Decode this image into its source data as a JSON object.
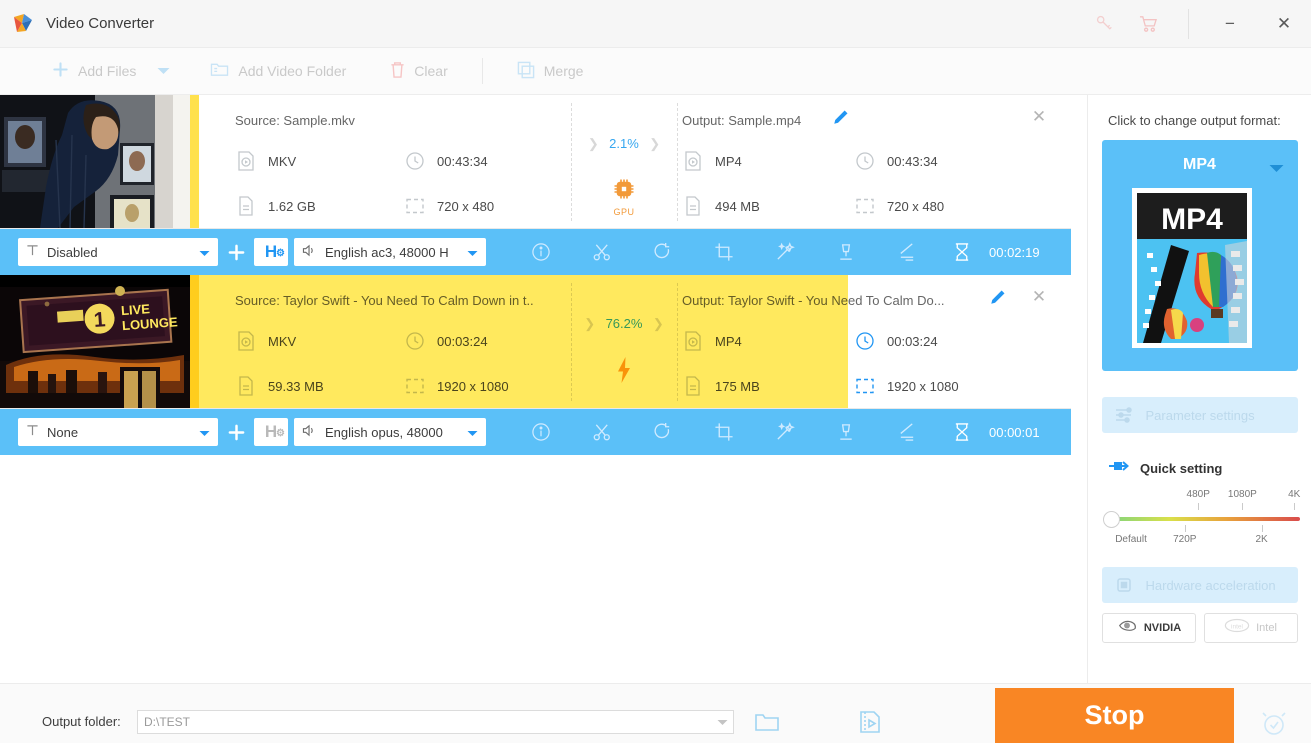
{
  "window": {
    "title": "Video Converter",
    "icons": {
      "key": "key-icon",
      "cart": "cart-icon",
      "minimize": "−",
      "close": "✕"
    }
  },
  "toolbar": {
    "add_files": "Add Files",
    "add_video_folder": "Add Video Folder",
    "clear": "Clear",
    "merge": "Merge"
  },
  "files": [
    {
      "source_label": "Source: Sample.mkv",
      "output_label": "Output: Sample.mp4",
      "source_format": "MKV",
      "source_duration": "00:43:34",
      "source_size": "1.62 GB",
      "source_resolution": "720 x 480",
      "output_format": "MP4",
      "output_duration": "00:43:34",
      "output_size": "494 MB",
      "output_resolution": "720 x 480",
      "progress_percent": "2.1%",
      "progress_value": 2.1,
      "accel_badge": "GPU",
      "accel_type": "gpu",
      "subtitle_track": "Disabled",
      "audio_track": "English ac3, 48000 H",
      "eta": "00:02:19",
      "codec_badge": "H",
      "codec_active": true,
      "thumbnail": "man-in-dark-room"
    },
    {
      "source_label": "Source: Taylor Swift - You Need To Calm Down in t..",
      "output_label": "Output: Taylor Swift - You Need To Calm Do...",
      "source_format": "MKV",
      "source_duration": "00:03:24",
      "source_size": "59.33 MB",
      "source_resolution": "1920 x 1080",
      "output_format": "MP4",
      "output_duration": "00:03:24",
      "output_size": "175 MB",
      "output_resolution": "1920 x 1080",
      "progress_percent": "76.2%",
      "progress_value": 76.2,
      "accel_badge": "",
      "accel_type": "lightning",
      "subtitle_track": "None",
      "audio_track": "English opus, 48000",
      "eta": "00:00:01",
      "codec_badge": "H",
      "codec_active": false,
      "thumbnail": "bbc-radio-1-live-lounge"
    }
  ],
  "right_panel": {
    "hint": "Click to change output format:",
    "format_name": "MP4",
    "format_thumb_label": "MP4",
    "parameter_settings": "Parameter settings",
    "quick_setting": "Quick setting",
    "slider": {
      "handle_position_percent": 0,
      "top_ticks": [
        {
          "label": "480P",
          "pos": 47
        },
        {
          "label": "1080P",
          "pos": 70
        },
        {
          "label": "4K",
          "pos": 97
        }
      ],
      "bottom_ticks": [
        {
          "label": "Default",
          "pos": 5
        },
        {
          "label": "720P",
          "pos": 40
        },
        {
          "label": "2K",
          "pos": 80
        }
      ]
    },
    "hardware_acceleration": "Hardware acceleration",
    "nvidia": "NVIDIA",
    "intel": "Intel"
  },
  "bottom": {
    "output_folder_label": "Output folder:",
    "output_folder_value": "D:\\TEST",
    "open_folder_icon": "folder-icon",
    "media_icon": "media-folder-icon",
    "stop_label": "Stop",
    "alarm_icon": "alarm-clock-icon"
  },
  "colors": {
    "accent_blue": "#5bc0f8",
    "progress_yellow": "#ffe95e",
    "stop_orange": "#f98624",
    "gpu_orange": "#f29a3a"
  }
}
